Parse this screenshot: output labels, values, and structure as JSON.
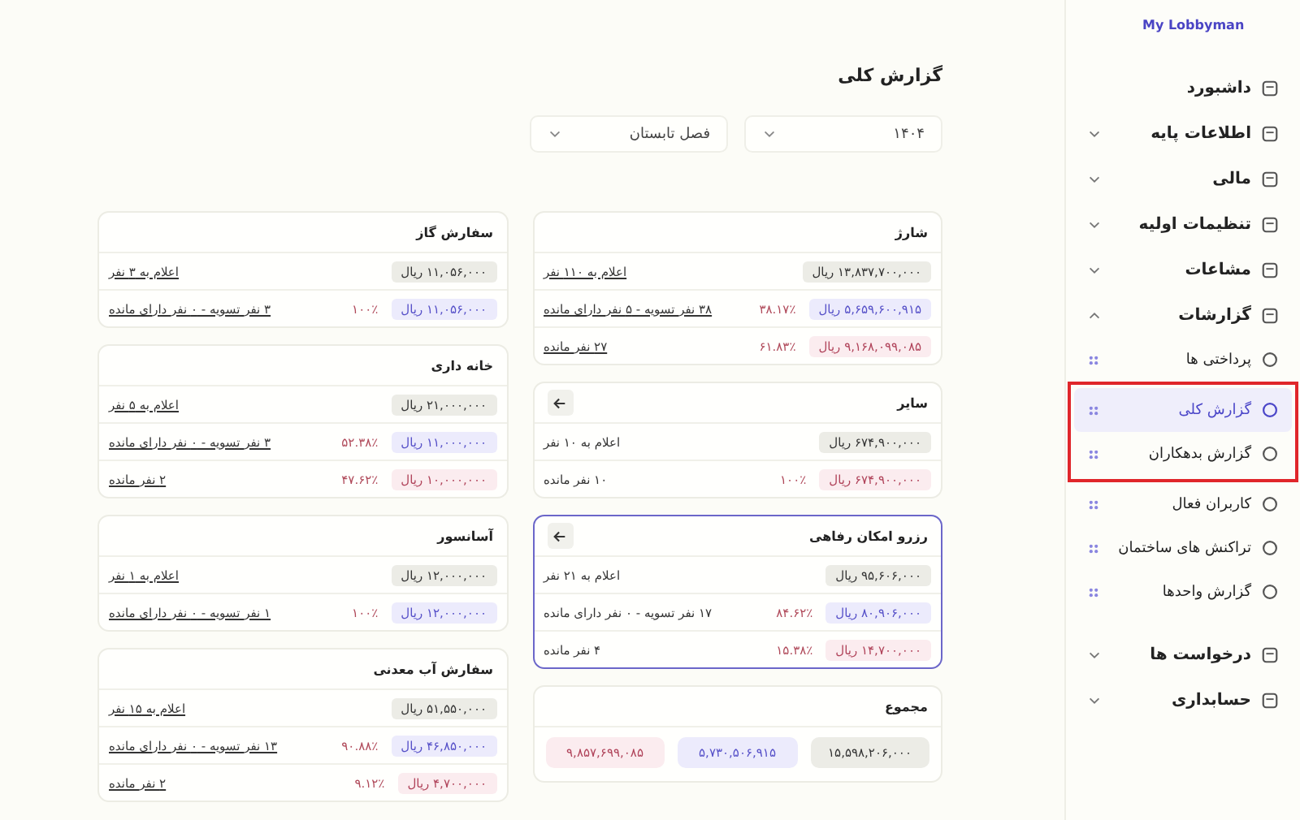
{
  "sidebar": {
    "logo": "My Lobbyman",
    "items": [
      {
        "label": "داشبورد",
        "kind": "link",
        "selected": false
      },
      {
        "label": "اطلاعات پایه",
        "kind": "group",
        "expanded": false,
        "selected": false
      },
      {
        "label": "مالی",
        "kind": "group",
        "expanded": false,
        "selected": false
      },
      {
        "label": "تنظیمات اولیه",
        "kind": "group",
        "expanded": false,
        "selected": false
      },
      {
        "label": "مشاعات",
        "kind": "group",
        "expanded": false,
        "selected": false
      },
      {
        "label": "گزارشات",
        "kind": "group",
        "expanded": true,
        "selected": false,
        "children": [
          {
            "label": "پرداختی ها",
            "selected": false,
            "boxed": false
          },
          {
            "label": "گزارش کلی",
            "selected": true,
            "boxed": true
          },
          {
            "label": "گزارش بدهکاران",
            "selected": false,
            "boxed": true
          },
          {
            "label": "کاربران فعال",
            "selected": false,
            "boxed": false
          },
          {
            "label": "تراکنش های ساختمان",
            "selected": false,
            "boxed": false
          },
          {
            "label": "گزارش واحدها",
            "selected": false,
            "boxed": false
          }
        ]
      },
      {
        "label": "درخواست ها",
        "kind": "group",
        "expanded": false,
        "selected": false
      },
      {
        "label": "حسابداری",
        "kind": "group",
        "expanded": false,
        "selected": false
      }
    ]
  },
  "page": {
    "title": "گزارش کلی",
    "filters": [
      {
        "value": "۱۴۰۴"
      },
      {
        "value": "فصل تابستان"
      }
    ]
  },
  "columns": [
    {
      "cards": [
        {
          "title": "شارژ",
          "arrow": false,
          "selected": false,
          "rows": [
            {
              "kind": "total",
              "amount": "۱۳,۸۳۷,۷۰۰,۰۰۰ ریال",
              "text": "اعلام به ۱۱۰ نفر",
              "link": true
            },
            {
              "kind": "paid",
              "amount": "۵,۶۵۹,۶۰۰,۹۱۵ ریال",
              "percent": "۳۸.۱۷٪",
              "text": "۳۸ نفر تسویه - ۵ نفر دارای مانده",
              "link": true
            },
            {
              "kind": "remaining",
              "amount": "۹,۱۶۸,۰۹۹,۰۸۵ ریال",
              "percent": "۶۱.۸۳٪",
              "text": "۲۷ نفر مانده",
              "link": true
            }
          ]
        },
        {
          "title": "سایر",
          "arrow": true,
          "selected": false,
          "rows": [
            {
              "kind": "total",
              "amount": "۶۷۴,۹۰۰,۰۰۰ ریال",
              "text": "اعلام به ۱۰ نفر",
              "link": false
            },
            {
              "kind": "remaining",
              "amount": "۶۷۴,۹۰۰,۰۰۰ ریال",
              "percent": "۱۰۰٪",
              "text": "۱۰ نفر مانده",
              "link": false
            }
          ]
        },
        {
          "title": "رزرو امکان رفاهی",
          "arrow": true,
          "selected": true,
          "rows": [
            {
              "kind": "total",
              "amount": "۹۵,۶۰۶,۰۰۰ ریال",
              "text": "اعلام به ۲۱ نفر",
              "link": false
            },
            {
              "kind": "paid",
              "amount": "۸۰,۹۰۶,۰۰۰ ریال",
              "percent": "۸۴.۶۲٪",
              "text": "۱۷ نفر تسویه - ۰ نفر دارای مانده",
              "link": false
            },
            {
              "kind": "remaining",
              "amount": "۱۴,۷۰۰,۰۰۰ ریال",
              "percent": "۱۵.۳۸٪",
              "text": "۴ نفر مانده",
              "link": false
            }
          ]
        }
      ],
      "summary": {
        "title": "مجموع",
        "values": [
          {
            "kind": "total",
            "amount": "۱۵,۵۹۸,۲۰۶,۰۰۰"
          },
          {
            "kind": "paid",
            "amount": "۵,۷۳۰,۵۰۶,۹۱۵"
          },
          {
            "kind": "remaining",
            "amount": "۹,۸۵۷,۶۹۹,۰۸۵"
          }
        ]
      }
    },
    {
      "cards": [
        {
          "title": "سفارش گاز",
          "arrow": false,
          "selected": false,
          "rows": [
            {
              "kind": "total",
              "amount": "۱۱,۰۵۶,۰۰۰ ریال",
              "text": "اعلام به ۳ نفر",
              "link": true
            },
            {
              "kind": "paid",
              "amount": "۱۱,۰۵۶,۰۰۰ ریال",
              "percent": "۱۰۰٪",
              "text": "۳ نفر تسویه - ۰ نفر دارای مانده",
              "link": true
            }
          ]
        },
        {
          "title": "خانه داری",
          "arrow": false,
          "selected": false,
          "rows": [
            {
              "kind": "total",
              "amount": "۲۱,۰۰۰,۰۰۰ ریال",
              "text": "اعلام به ۵ نفر",
              "link": true
            },
            {
              "kind": "paid",
              "amount": "۱۱,۰۰۰,۰۰۰ ریال",
              "percent": "۵۲.۳۸٪",
              "text": "۳ نفر تسویه - ۰ نفر دارای مانده",
              "link": true
            },
            {
              "kind": "remaining",
              "amount": "۱۰,۰۰۰,۰۰۰ ریال",
              "percent": "۴۷.۶۲٪",
              "text": "۲ نفر مانده",
              "link": true
            }
          ]
        },
        {
          "title": "آسانسور",
          "arrow": false,
          "selected": false,
          "rows": [
            {
              "kind": "total",
              "amount": "۱۲,۰۰۰,۰۰۰ ریال",
              "text": "اعلام به ۱ نفر",
              "link": true
            },
            {
              "kind": "paid",
              "amount": "۱۲,۰۰۰,۰۰۰ ریال",
              "percent": "۱۰۰٪",
              "text": "۱ نفر تسویه - ۰ نفر دارای مانده",
              "link": true
            }
          ]
        },
        {
          "title": "سفارش آب معدنی",
          "arrow": false,
          "selected": false,
          "rows": [
            {
              "kind": "total",
              "amount": "۵۱,۵۵۰,۰۰۰ ریال",
              "text": "اعلام به ۱۵ نفر",
              "link": true
            },
            {
              "kind": "paid",
              "amount": "۴۶,۸۵۰,۰۰۰ ریال",
              "percent": "۹۰.۸۸٪",
              "text": "۱۳ نفر تسویه - ۰ نفر دارای مانده",
              "link": true
            },
            {
              "kind": "remaining",
              "amount": "۴,۷۰۰,۰۰۰ ریال",
              "percent": "۹.۱۲٪",
              "text": "۲ نفر مانده",
              "link": true
            }
          ]
        }
      ]
    }
  ]
}
